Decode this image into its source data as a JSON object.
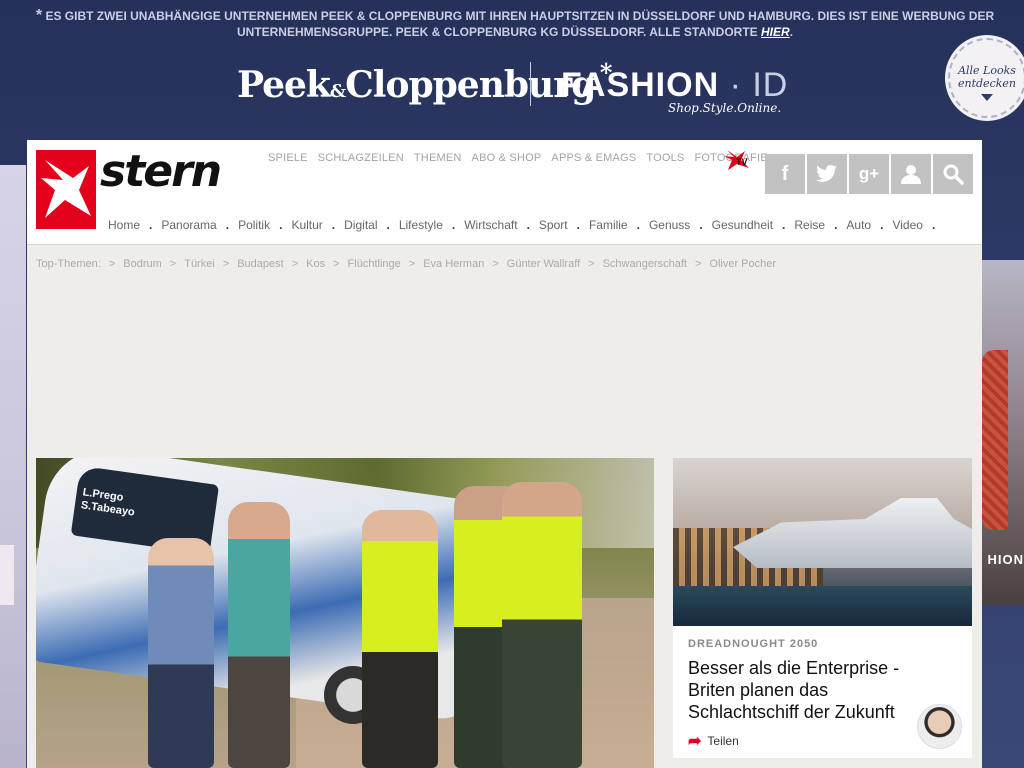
{
  "ad": {
    "disclaimer_star": "*",
    "disclaimer_line1": "ES GIBT ZWEI UNABHÄNGIGE UNTERNEHMEN PEEK & CLOPPENBURG MIT IHREN HAUPTSITZEN IN DÜSSELDORF UND HAMBURG. DIES IST EINE WERBUNG DER",
    "disclaimer_line2": "UNTERNEHMENSGRUPPE. PEEK & CLOPPENBURG KG DÜSSELDORF. ALLE STANDORTE",
    "disclaimer_link": "HIER",
    "disclaimer_end": ".",
    "brand_left": "Peek",
    "brand_amp": "&",
    "brand_right": "Cloppenburg",
    "brand_star": "*",
    "fashion_word": "FASHION",
    "fashion_dot": "·",
    "fashion_id": "ID",
    "fashion_tagline": "Shop.Style.Online.",
    "badge_line1": "Alle Looks",
    "badge_line2": "entdecken",
    "side_text": "HION"
  },
  "header": {
    "logo_text": "stern",
    "top_links": [
      "SPIELE",
      "SCHLAGZEILEN",
      "THEMEN",
      "ABO & SHOP",
      "APPS & EMAGS",
      "TOOLS",
      "FOTOGRAFIE"
    ],
    "social_icons": [
      "facebook-icon",
      "twitter-icon",
      "googleplus-icon",
      "user-icon",
      "search-icon"
    ],
    "social_glyphs": [
      "f",
      "🐦",
      "g+",
      "👤",
      "🔍"
    ],
    "nav": [
      "Home",
      "Panorama",
      "Politik",
      "Kultur",
      "Digital",
      "Lifestyle",
      "Wirtschaft",
      "Sport",
      "Familie",
      "Genuss",
      "Gesundheit",
      "Reise",
      "Auto",
      "Video"
    ],
    "nav_sep": "."
  },
  "topics": {
    "label": "Top-Themen:",
    "sep": ">",
    "items": [
      "Bodrum",
      "Türkei",
      "Budapest",
      "Kos",
      "Flüchtlinge",
      "Eva Herman",
      "Günter Wallraff",
      "Schwangerschaft",
      "Oliver Pocher"
    ]
  },
  "hero": {
    "car_label_1": "L.Prego",
    "car_label_2": "S.Tabeayo"
  },
  "teaser": {
    "kicker": "DREADNOUGHT 2050",
    "headline_1": "Besser als die Enterprise -",
    "headline_2": "Briten planen das",
    "headline_3": "Schlachtschiff der Zukunft",
    "share_label": "Teilen"
  },
  "colors": {
    "stern_red": "#e3001b",
    "ad_navy": "#2e3a68",
    "content_grey": "#efedea"
  }
}
